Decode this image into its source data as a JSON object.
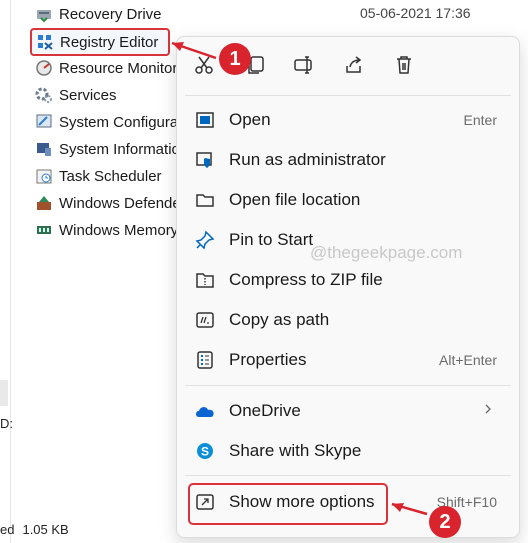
{
  "file_list": {
    "items": [
      {
        "label": "Recovery Drive",
        "icon": "recovery-drive-icon"
      },
      {
        "label": "Registry Editor",
        "icon": "registry-editor-icon",
        "selected": true
      },
      {
        "label": "Resource Monitor",
        "icon": "resource-monitor-icon"
      },
      {
        "label": "Services",
        "icon": "services-icon"
      },
      {
        "label": "System Configuration",
        "icon": "system-configuration-icon"
      },
      {
        "label": "System Information",
        "icon": "system-information-icon"
      },
      {
        "label": "Task Scheduler",
        "icon": "task-scheduler-icon"
      },
      {
        "label": "Windows Defender Firewall",
        "icon": "firewall-icon"
      },
      {
        "label": "Windows Memory Diagnostic",
        "icon": "memory-diagnostic-icon"
      }
    ],
    "first_row_date": "05-06-2021 17:36"
  },
  "left_panel": {
    "colon_fragment": "D:",
    "status_prefix": "ed",
    "status_size": "1.05 KB"
  },
  "context_menu": {
    "quick_actions": [
      "cut-icon",
      "copy-icon",
      "rename-icon",
      "share-icon",
      "delete-icon"
    ],
    "items": [
      {
        "label": "Open",
        "shortcut": "Enter",
        "icon": "open-icon"
      },
      {
        "label": "Run as administrator",
        "shortcut": "",
        "icon": "shield-icon"
      },
      {
        "label": "Open file location",
        "shortcut": "",
        "icon": "folder-icon"
      },
      {
        "label": "Pin to Start",
        "shortcut": "",
        "icon": "pin-icon"
      },
      {
        "label": "Compress to ZIP file",
        "shortcut": "",
        "icon": "zip-icon"
      },
      {
        "label": "Copy as path",
        "shortcut": "",
        "icon": "path-icon"
      },
      {
        "label": "Properties",
        "shortcut": "Alt+Enter",
        "icon": "properties-icon"
      },
      {
        "label": "OneDrive",
        "shortcut": "",
        "icon": "onedrive-icon",
        "submenu": true
      },
      {
        "label": "Share with Skype",
        "shortcut": "",
        "icon": "skype-icon"
      },
      {
        "label": "Show more options",
        "shortcut": "Shift+F10",
        "icon": "more-options-icon"
      }
    ]
  },
  "watermark": "@thegeekpage.com",
  "annotations": {
    "step1": "1",
    "step2": "2",
    "color": "#d9232d"
  },
  "colors": {
    "accent": "#0067c0",
    "highlight": "#d9343b"
  }
}
